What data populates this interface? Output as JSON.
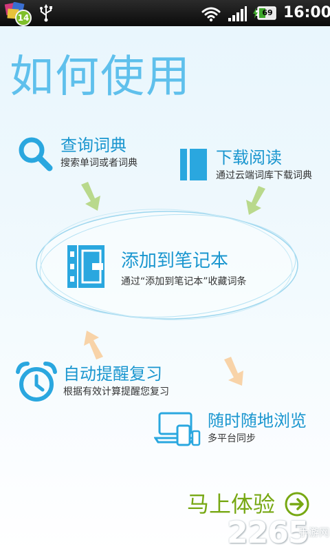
{
  "status_bar": {
    "notification_count": "14",
    "battery_level": "69",
    "time": "16:00"
  },
  "page_title": "如何使用",
  "features": {
    "lookup": {
      "title": "查询词典",
      "description": "搜索单词或者词典",
      "icon": "search-icon"
    },
    "download": {
      "title": "下载阅读",
      "description": "通过云端词库下载词典",
      "icon": "book-columns-icon"
    },
    "notebook": {
      "title": "添加到笔记本",
      "description": "通过“添加到笔记本”收藏词条",
      "icon": "notebook-icon"
    },
    "review": {
      "title": "自动提醒复习",
      "description": "根据有效计算提醒您复习",
      "icon": "alarm-clock-icon"
    },
    "sync": {
      "title": "随时随地浏览",
      "description": "多平台同步",
      "icon": "devices-icon"
    }
  },
  "cta": {
    "label": "马上体验",
    "icon": "arrow-right-circle-icon"
  },
  "watermark": {
    "number": "2265",
    "site": "手游网"
  },
  "colors": {
    "accent_blue": "#1a96cf",
    "title_blue": "#5fc0ec",
    "icon_blue": "#2aa7df",
    "green_arrow": "#b9d98c",
    "orange_arrow": "#f8d3a8",
    "cta_green": "#77a813"
  }
}
